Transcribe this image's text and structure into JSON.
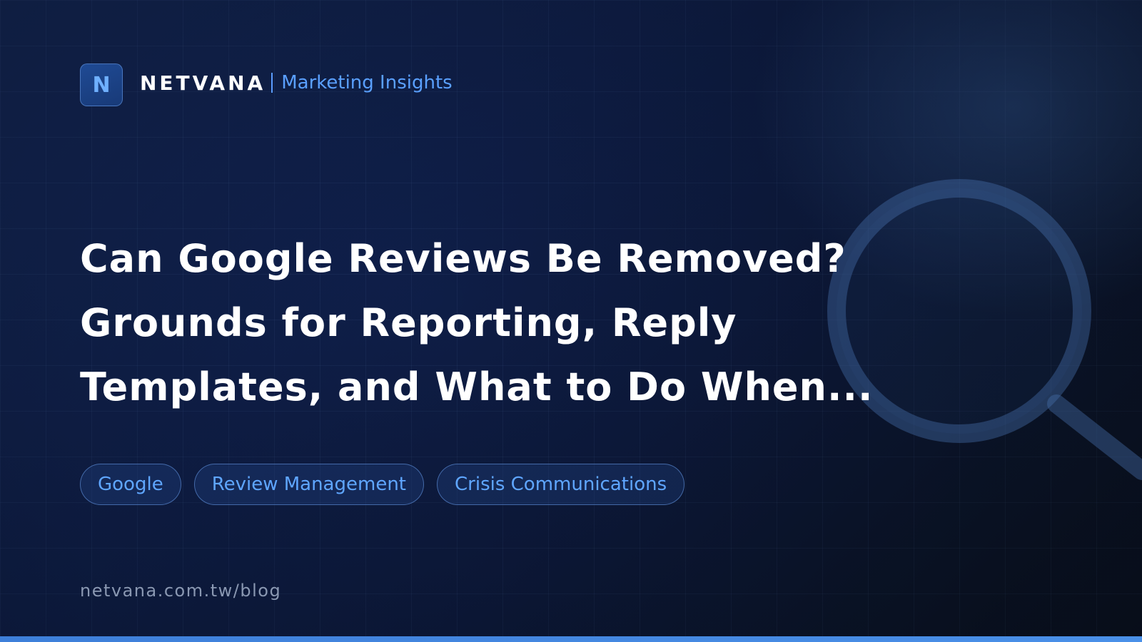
{
  "brand": {
    "logo_letter": "N",
    "name": "NETVANA",
    "subtitle": "Marketing Insights"
  },
  "headline": {
    "line1": "Can Google Reviews Be Removed?",
    "line2": "Grounds for Reporting, Reply",
    "line3": "Templates, and What to Do When..."
  },
  "tags": [
    {
      "label": "Google"
    },
    {
      "label": "Review Management"
    },
    {
      "label": "Crisis Communications"
    }
  ],
  "footer": {
    "url": "netvana.com.tw/blog"
  },
  "colors": {
    "accent": "#5aa0ff",
    "background_dark": "#0d1a3e",
    "bottom_bar": "#4a90e8"
  },
  "icons": {
    "background_decoration": "magnifier-icon"
  }
}
